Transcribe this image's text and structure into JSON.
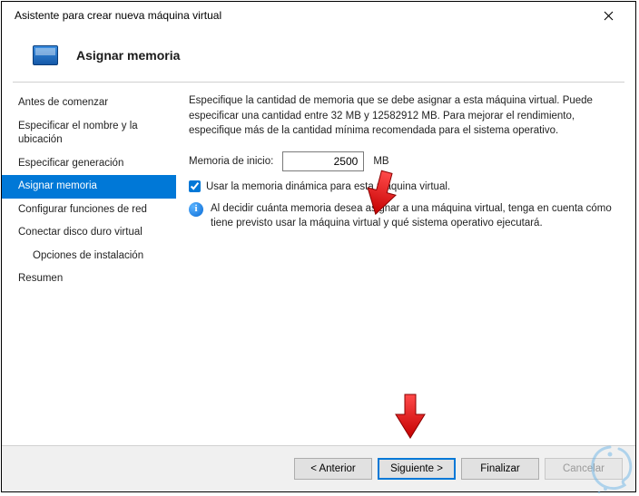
{
  "window": {
    "title": "Asistente para crear nueva máquina virtual"
  },
  "header": {
    "title": "Asignar memoria"
  },
  "sidebar": {
    "items": [
      {
        "label": "Antes de comenzar",
        "indent": false
      },
      {
        "label": "Especificar el nombre y la ubicación",
        "indent": false
      },
      {
        "label": "Especificar generación",
        "indent": false
      },
      {
        "label": "Asignar memoria",
        "indent": false,
        "active": true
      },
      {
        "label": "Configurar funciones de red",
        "indent": false
      },
      {
        "label": "Conectar disco duro virtual",
        "indent": false
      },
      {
        "label": "Opciones de instalación",
        "indent": true
      },
      {
        "label": "Resumen",
        "indent": false
      }
    ]
  },
  "content": {
    "description": "Especifique la cantidad de memoria que se debe asignar a esta máquina virtual. Puede especificar una cantidad entre 32 MB y 12582912 MB. Para mejorar el rendimiento, especifique más de la cantidad mínima recomendada para el sistema operativo.",
    "memory_label": "Memoria de inicio:",
    "memory_value": "2500",
    "memory_unit": "MB",
    "dynamic_checked": true,
    "dynamic_label": "Usar la memoria dinámica para esta máquina virtual.",
    "info_text": "Al decidir cuánta memoria desea asignar a una máquina virtual, tenga en cuenta cómo tiene previsto usar la máquina virtual y qué sistema operativo ejecutará."
  },
  "footer": {
    "back": "< Anterior",
    "next": "Siguiente >",
    "finish": "Finalizar",
    "cancel": "Cancelar"
  }
}
